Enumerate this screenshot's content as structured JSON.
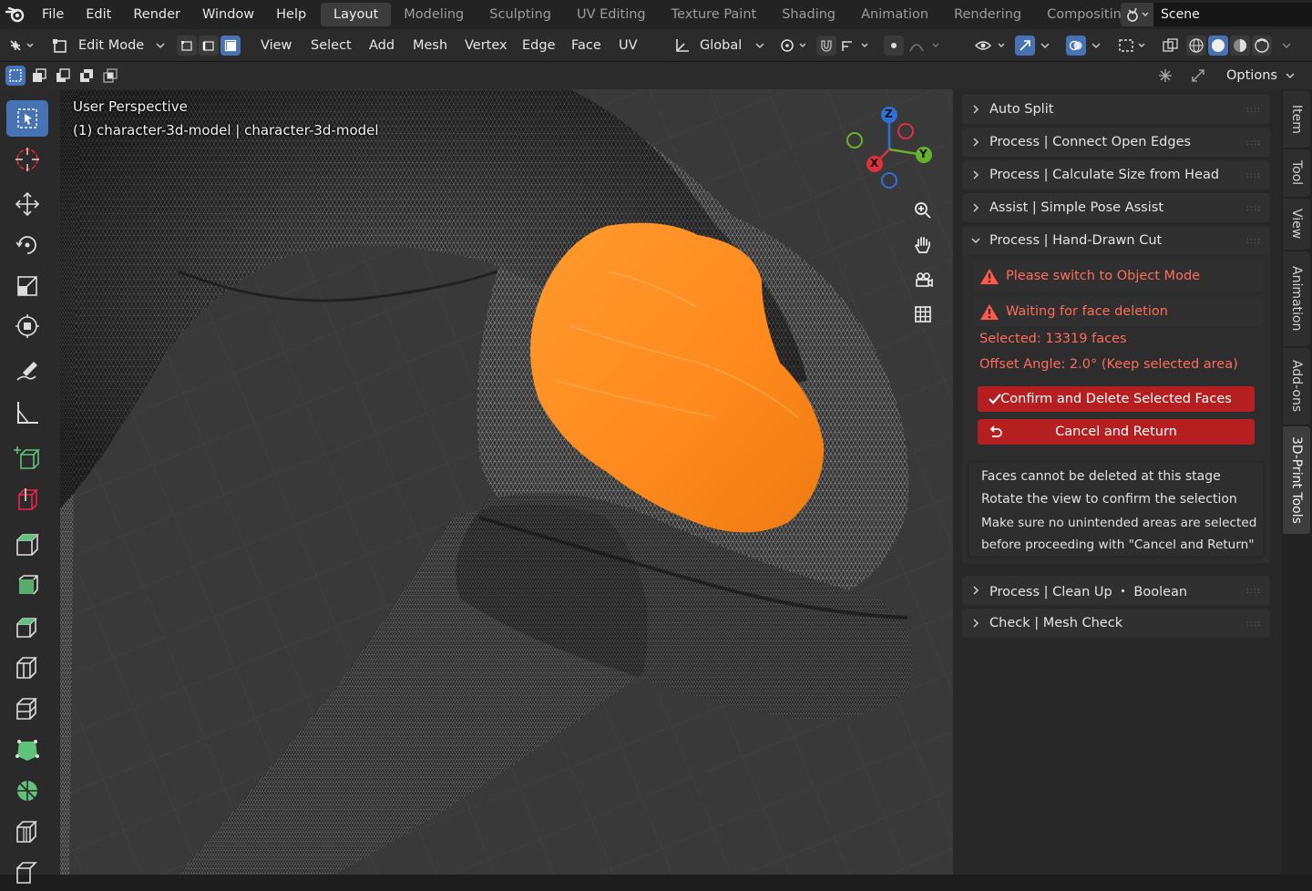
{
  "menu": {
    "items": [
      "File",
      "Edit",
      "Render",
      "Window",
      "Help"
    ]
  },
  "workspaces": {
    "tabs": [
      "Layout",
      "Modeling",
      "Sculpting",
      "UV Editing",
      "Texture Paint",
      "Shading",
      "Animation",
      "Rendering",
      "Compositing"
    ],
    "active": "Layout"
  },
  "scene": {
    "label": "Scene"
  },
  "header": {
    "mode": "Edit Mode",
    "menus": [
      "View",
      "Select",
      "Add",
      "Mesh",
      "Vertex",
      "Edge",
      "Face",
      "UV"
    ],
    "orientation": "Global",
    "options": "Options"
  },
  "viewport": {
    "title": "User Perspective",
    "object": "(1) character-3d-model | character-3d-model",
    "gizmo": {
      "z": "Z",
      "x": "X",
      "y": "Y"
    }
  },
  "panel": {
    "headers": {
      "auto_split": "Auto Split",
      "connect_edges": "Process | Connect Open Edges",
      "calc_size": "Process | Calculate Size from Head",
      "pose_assist": "Assist | Simple Pose Assist",
      "hand_cut": "Process | Hand-Drawn Cut",
      "clean_up": "Process | Clean Up ・ Boolean",
      "mesh_check": "Check | Mesh Check"
    },
    "warning1": "Please switch to Object Mode",
    "warning2": "Waiting for face deletion",
    "selected": "Selected: 13319 faces",
    "offset": "Offset Angle: 2.0° (Keep selected area)",
    "confirm_label": "Confirm and Delete Selected Faces",
    "cancel_label": "Cancel and Return",
    "note": [
      "Faces cannot be deleted at this stage",
      "Rotate the view to confirm the selection",
      "Make sure no unintended areas are selected",
      "before proceeding with \"Cancel and Return\""
    ]
  },
  "side_tabs": [
    "Item",
    "Tool",
    "View",
    "Animation",
    "Add-ons",
    "3D-Print Tools"
  ],
  "colors": {
    "accent_blue": "#4772b3",
    "selection_orange": "#ff8a1e",
    "danger_red": "#b51f1f",
    "warning_text": "#ff6d5a"
  }
}
